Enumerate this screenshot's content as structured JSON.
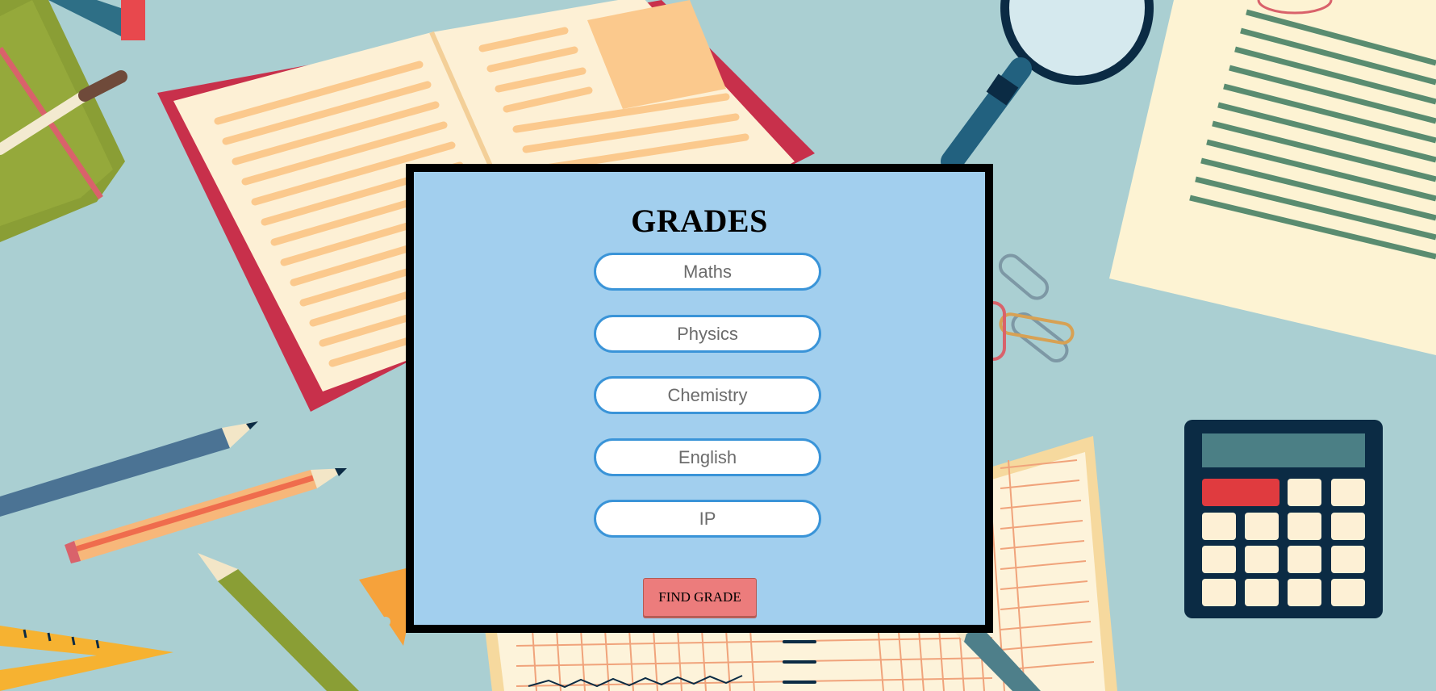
{
  "form": {
    "title": "GRADES",
    "subjects": [
      {
        "placeholder": "Maths"
      },
      {
        "placeholder": "Physics"
      },
      {
        "placeholder": "Chemistry"
      },
      {
        "placeholder": "English"
      },
      {
        "placeholder": "IP"
      }
    ],
    "submit_label": "FIND GRADE"
  },
  "colors": {
    "page_background": "#aacfd2",
    "card_background": "#a2cfee",
    "card_border": "#000000",
    "input_border": "#3a94d8",
    "button_background": "#ec7c7c"
  }
}
